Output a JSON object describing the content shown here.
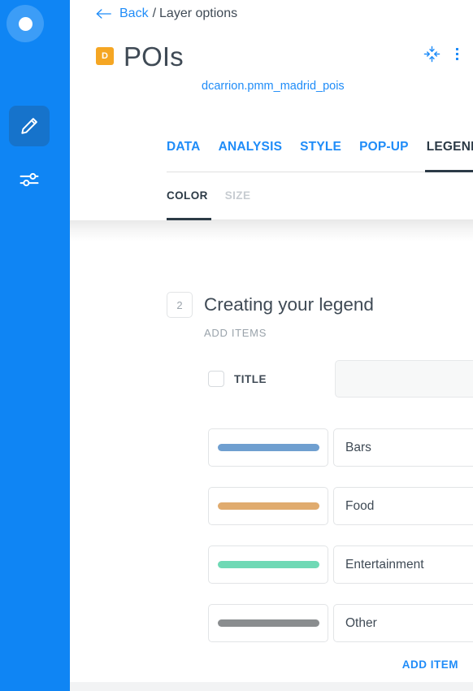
{
  "colors": {
    "brand_blue": "#0f85f4",
    "link_blue": "#1f8cf8",
    "dark_text": "#3f4a55",
    "badge_orange": "#f5a623",
    "muted": "#9aa3ab"
  },
  "sidebar": {
    "avatar": {
      "icon": "user-avatar-circle"
    },
    "items": [
      {
        "icon": "pencil-icon",
        "name": "edit",
        "active": true
      },
      {
        "icon": "sliders-icon",
        "name": "settings",
        "active": false
      }
    ]
  },
  "breadcrumb": {
    "back_icon": "arrow-left-icon",
    "back_label": "Back",
    "separator": "/",
    "current": "Layer options"
  },
  "header": {
    "type_badge": "D",
    "title": "POIs",
    "dataset": "dcarrion.pmm_madrid_pois",
    "actions": [
      {
        "name": "collapse-icon",
        "icon": "collapse-arrows-icon"
      },
      {
        "name": "more-options-icon",
        "icon": "kebab-menu-icon"
      }
    ]
  },
  "tabs": [
    {
      "label": "DATA",
      "active": false
    },
    {
      "label": "ANALYSIS",
      "active": false
    },
    {
      "label": "STYLE",
      "active": false
    },
    {
      "label": "POP-UP",
      "active": false
    },
    {
      "label": "LEGEND",
      "active": true
    }
  ],
  "subtabs": [
    {
      "label": "COLOR",
      "active": true,
      "disabled": false
    },
    {
      "label": "SIZE",
      "active": false,
      "disabled": true
    }
  ],
  "section": {
    "step": "2",
    "title": "Creating your legend",
    "subtitle": "ADD ITEMS"
  },
  "title_row": {
    "label": "TITLE",
    "checked": false,
    "value": "",
    "placeholder": ""
  },
  "legend_items": [
    {
      "label": "Bars",
      "color": "#6f9fd0"
    },
    {
      "label": "Food",
      "color": "#e0ab6e"
    },
    {
      "label": "Entertainment",
      "color": "#6fd9b5"
    },
    {
      "label": "Other",
      "color": "#8a8d8f"
    }
  ],
  "footer": {
    "add_item_label": "ADD ITEM"
  }
}
